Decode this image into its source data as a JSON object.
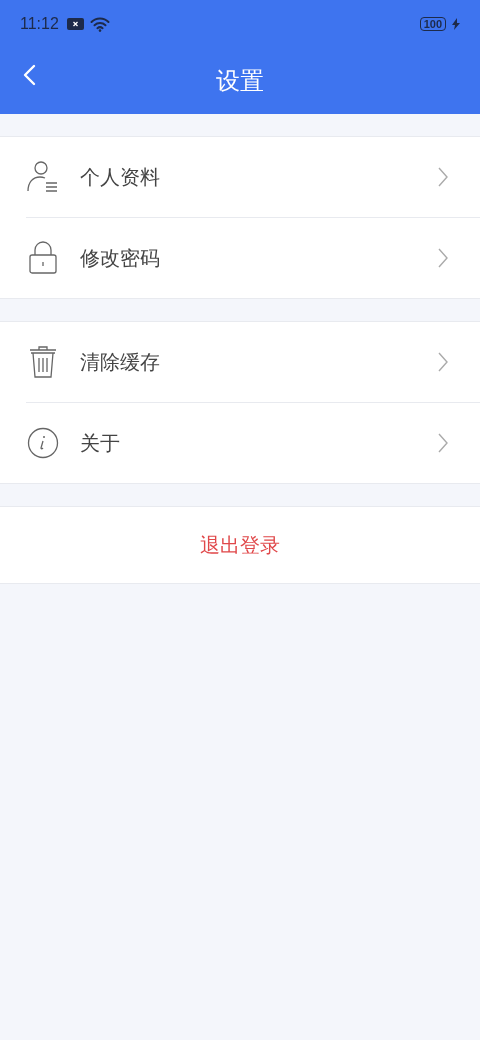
{
  "status_bar": {
    "time": "11:12",
    "battery": "100"
  },
  "header": {
    "title": "设置"
  },
  "groups": [
    {
      "items": [
        {
          "kind": "profile",
          "label": "个人资料"
        },
        {
          "kind": "password",
          "label": "修改密码"
        }
      ]
    },
    {
      "items": [
        {
          "kind": "cache",
          "label": "清除缓存"
        },
        {
          "kind": "about",
          "label": "关于"
        }
      ]
    }
  ],
  "logout": {
    "label": "退出登录"
  }
}
